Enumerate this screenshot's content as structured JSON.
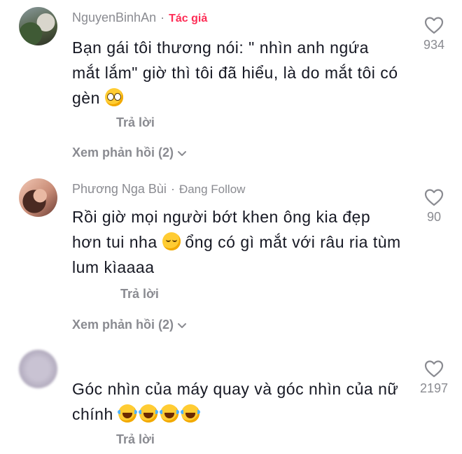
{
  "comments": [
    {
      "username": "NguyenBinhAn",
      "separator": "·",
      "badge": "Tác giả",
      "text_parts": [
        "Bạn gái tôi thương nói: \" nhìn anh ngứa mắt lắm\" giờ thì tôi đã hiểu, là do mắt tôi có gèn "
      ],
      "emoji": [
        "flushed-face-emoji"
      ],
      "reply_label": "Trả lời",
      "view_replies": "Xem phản hồi (2)",
      "likes": "934"
    },
    {
      "username": "Phương Nga Bùi",
      "separator": "·",
      "badge": "Đang Follow",
      "text_parts": [
        "Rồi giờ mọi người bớt khen ông kia đẹp hơn tui nha ",
        " ổng có gì mắt với râu ria tùm lum kìaaaa"
      ],
      "emoji": [
        "relieved-face-emoji"
      ],
      "reply_label": "Trả lời",
      "view_replies": "Xem phản hồi (2)",
      "likes": "90"
    },
    {
      "username": "",
      "text_parts": [
        "Góc nhìn của máy quay và góc nhìn của nữ chính "
      ],
      "emoji": [
        "laughing-tears-emoji",
        "laughing-tears-emoji",
        "laughing-tears-emoji",
        "laughing-tears-emoji"
      ],
      "reply_label": "Trả lời",
      "likes": "2197"
    }
  ],
  "icons": {
    "like": "heart-outline-icon",
    "expand": "chevron-down-icon"
  },
  "colors": {
    "author_badge": "#fe2c55",
    "secondary_text": "#8a8b91",
    "primary_text": "#161823"
  }
}
